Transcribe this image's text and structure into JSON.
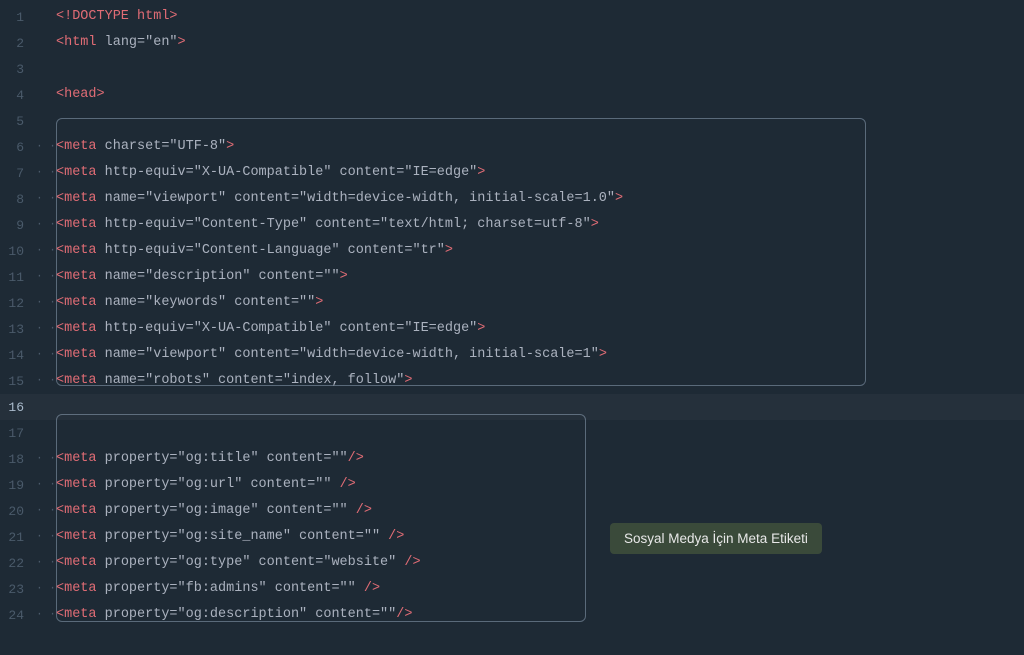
{
  "lines": [
    {
      "num": "1",
      "dots": "",
      "content": "<!DOCTYPE html>",
      "type": "doctype"
    },
    {
      "num": "2",
      "dots": "",
      "content": "<html lang=\"en\">",
      "type": "normal"
    },
    {
      "num": "3",
      "dots": "",
      "content": "",
      "type": "empty"
    },
    {
      "num": "4",
      "dots": "",
      "content": "<head>",
      "type": "normal"
    },
    {
      "num": "5",
      "dots": "",
      "content": "",
      "type": "empty"
    },
    {
      "num": "6",
      "dots": "· ·",
      "content": "<meta charset=\"UTF-8\">",
      "type": "meta"
    },
    {
      "num": "7",
      "dots": "· ·",
      "content": "<meta http-equiv=\"X-UA-Compatible\" content=\"IE=edge\">",
      "type": "meta"
    },
    {
      "num": "8",
      "dots": "· ·",
      "content": "<meta name=\"viewport\" content=\"width=device-width, initial-scale=1.0\">",
      "type": "meta"
    },
    {
      "num": "9",
      "dots": "· ·",
      "content": "<meta http-equiv=\"Content-Type\" content=\"text/html; charset=utf-8\">",
      "type": "meta"
    },
    {
      "num": "10",
      "dots": "· ·",
      "content": "<meta http-equiv=\"Content-Language\" content=\"tr\">",
      "type": "meta"
    },
    {
      "num": "11",
      "dots": "· ·",
      "content": "<meta name=\"description\" content=\"\">",
      "type": "meta"
    },
    {
      "num": "12",
      "dots": "· ·",
      "content": "<meta name=\"keywords\" content=\"\">",
      "type": "meta"
    },
    {
      "num": "13",
      "dots": "· ·",
      "content": "<meta http-equiv=\"X-UA-Compatible\" content=\"IE=edge\">",
      "type": "meta"
    },
    {
      "num": "14",
      "dots": "· ·",
      "content": "<meta name=\"viewport\" content=\"width=device-width, initial-scale=1\">",
      "type": "meta"
    },
    {
      "num": "15",
      "dots": "· ·",
      "content": "<meta name=\"robots\" content=\"index, follow\">",
      "type": "meta"
    },
    {
      "num": "16",
      "dots": "",
      "content": "",
      "type": "active"
    },
    {
      "num": "17",
      "dots": "",
      "content": "",
      "type": "empty"
    },
    {
      "num": "18",
      "dots": "· ·",
      "content": "<meta property=\"og:title\" content=\"\"/>",
      "type": "og"
    },
    {
      "num": "19",
      "dots": "· ·",
      "content": "<meta property=\"og:url\" content=\"\" />",
      "type": "og"
    },
    {
      "num": "20",
      "dots": "· ·",
      "content": "<meta property=\"og:image\" content=\"\" />",
      "type": "og"
    },
    {
      "num": "21",
      "dots": "· ·",
      "content": "<meta property=\"og:site_name\" content=\"\" />",
      "type": "og"
    },
    {
      "num": "22",
      "dots": "· ·",
      "content": "<meta property=\"og:type\" content=\"website\" />",
      "type": "og"
    },
    {
      "num": "23",
      "dots": "· ·",
      "content": "<meta property=\"fb:admins\" content=\"\" />",
      "type": "og"
    },
    {
      "num": "24",
      "dots": "· ·",
      "content": "<meta property=\"og:description\" content=\"\"/>",
      "type": "og"
    }
  ],
  "tooltip": {
    "text": "Sosyal Medya İçin Meta Etiketi"
  }
}
